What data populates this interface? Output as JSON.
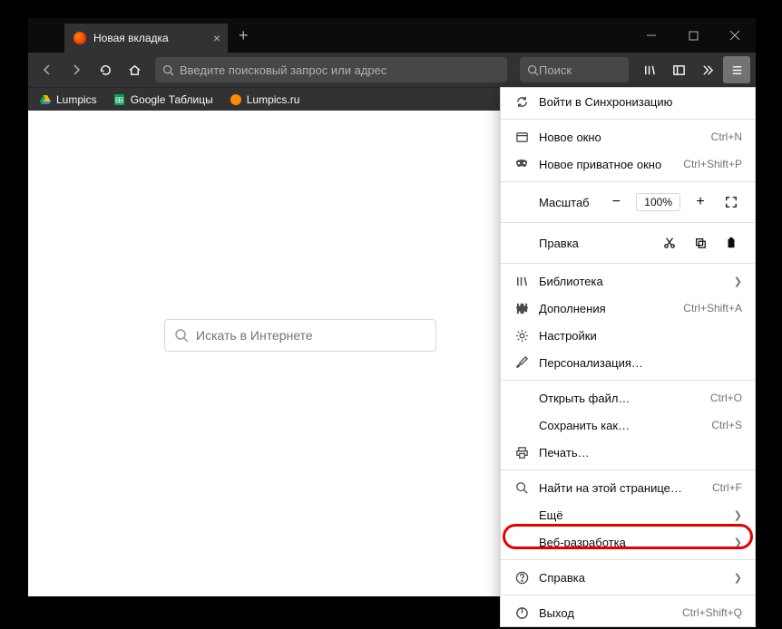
{
  "tab": {
    "title": "Новая вкладка"
  },
  "urlbar": {
    "placeholder": "Введите поисковый запрос или адрес"
  },
  "searchbar": {
    "placeholder": "Поиск"
  },
  "bookmarks": [
    {
      "label": "Lumpics",
      "icon": "drive"
    },
    {
      "label": "Google Таблицы",
      "icon": "sheets"
    },
    {
      "label": "Lumpics.ru",
      "icon": "orange"
    }
  ],
  "main_search": {
    "placeholder": "Искать в Интернете"
  },
  "menu": {
    "sync": "Войти в Синхронизацию",
    "new_window": {
      "label": "Новое окно",
      "shortcut": "Ctrl+N"
    },
    "new_private": {
      "label": "Новое приватное окно",
      "shortcut": "Ctrl+Shift+P"
    },
    "zoom": {
      "label": "Масштаб",
      "value": "100%"
    },
    "edit": {
      "label": "Правка"
    },
    "library": "Библиотека",
    "addons": {
      "label": "Дополнения",
      "shortcut": "Ctrl+Shift+A"
    },
    "settings": "Настройки",
    "customize": "Персонализация…",
    "open_file": {
      "label": "Открыть файл…",
      "shortcut": "Ctrl+O"
    },
    "save_as": {
      "label": "Сохранить как…",
      "shortcut": "Ctrl+S"
    },
    "print": "Печать…",
    "find": {
      "label": "Найти на этой странице…",
      "shortcut": "Ctrl+F"
    },
    "more": "Ещё",
    "webdev": "Веб-разработка",
    "help": "Справка",
    "exit": {
      "label": "Выход",
      "shortcut": "Ctrl+Shift+Q"
    }
  }
}
